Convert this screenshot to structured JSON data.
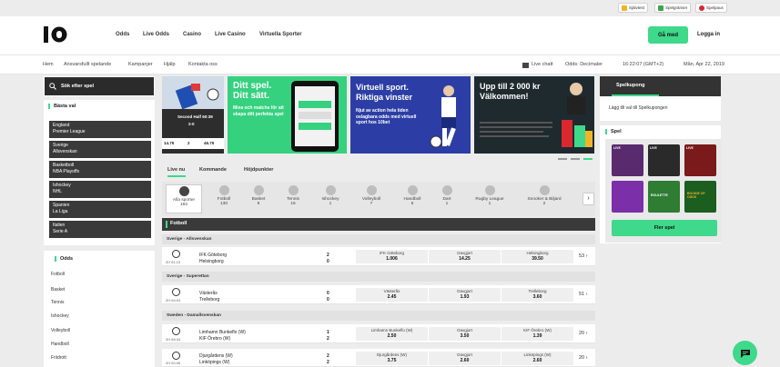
{
  "utility": {
    "sjalvtest": "Självtest",
    "spelgranser": "Spelgränser",
    "spelpaus": "Spelpaus"
  },
  "nav": {
    "items": [
      "Odds",
      "Live Odds",
      "Casino",
      "Live Casino",
      "Virtuella Sporter"
    ],
    "join": "Gå med",
    "login": "Logga in"
  },
  "subnav": {
    "links": [
      "Hem",
      "Ansvarsfullt spelande",
      "Kampanjer",
      "Hjälp",
      "Kontakta oss"
    ],
    "livechatt": "Live chatt",
    "odds_format": "Odds: Decimaler",
    "clock": "16:22:07 (GMT+2)",
    "date": "Mån, Apr 22, 2019"
  },
  "search": {
    "label": "Sök efter spel"
  },
  "bastavid": {
    "title": "Bästa val",
    "items": [
      [
        "England",
        "Premier League"
      ],
      [
        "Sverige",
        "Allsvenskan"
      ],
      [
        "Basketboll",
        "NBA Playoffs"
      ],
      [
        "Ishockey",
        "NHL"
      ],
      [
        "Spanien",
        "La Liga"
      ],
      [
        "Italien",
        "Serie A"
      ]
    ]
  },
  "oddslist": {
    "title": "Odds",
    "items": [
      "Fotboll",
      "Basket",
      "Tennis",
      "Ishockey",
      "Volleyboll",
      "Handboll",
      "Friidrott"
    ]
  },
  "banners": {
    "b1": {
      "line": "Second Half 60:39",
      "score": "2-0",
      "odds": [
        "14.75",
        "2",
        "46.75"
      ]
    },
    "b2": {
      "title1": "Ditt spel.",
      "title2": "Ditt sätt.",
      "body": "Mixa och matcha för att skapa ditt perfekta spel"
    },
    "b3": {
      "title1": "Virtuell sport.",
      "title2": "Riktiga vinster",
      "body": "Njut av action hela tiden oslagbara odds med virtuell sport hos 10bet"
    },
    "b4": {
      "title1": "Upp till 2 000 kr",
      "title2": "Välkommen!"
    }
  },
  "tabs": [
    "Live nu",
    "Kommande",
    "Höjdpunkter"
  ],
  "sports": [
    {
      "name": "Alla sporter",
      "count": "192"
    },
    {
      "name": "Fotboll",
      "count": "130"
    },
    {
      "name": "Basket",
      "count": "9"
    },
    {
      "name": "Tennis",
      "count": "16"
    },
    {
      "name": "Ishockey",
      "count": "1"
    },
    {
      "name": "Volleyboll",
      "count": "7"
    },
    {
      "name": "Handboll",
      "count": "5"
    },
    {
      "name": "Dart",
      "count": "1"
    },
    {
      "name": "Rugby League",
      "count": "1"
    },
    {
      "name": "Snooker & Biljard",
      "count": "2"
    }
  ],
  "section": "Fotboll",
  "matches": [
    {
      "league": "Sverige - Allsvenskan",
      "time": "2H 61:19",
      "home": "IFK Göteborg",
      "away": "Helsingborg",
      "sh": "2",
      "sa": "0",
      "o1": {
        "l": "IFK Göteborg",
        "v": "1.006"
      },
      "ox": {
        "l": "Oavgjort",
        "v": "14.25"
      },
      "o2": {
        "l": "Helsingborg",
        "v": "39.50"
      },
      "more": "53"
    },
    {
      "league": "Sverige - Superettan",
      "time": "2H 64:03",
      "home": "Västerås",
      "away": "Trelleborg",
      "sh": "0",
      "sa": "0",
      "o1": {
        "l": "Västerås",
        "v": "2.45"
      },
      "ox": {
        "l": "Oavgjort",
        "v": "1.93"
      },
      "o2": {
        "l": "Trelleborg",
        "v": "3.60"
      },
      "more": "51"
    },
    {
      "league": "Sweden - Damallsvenskan",
      "time": "2H 66:34",
      "home": "Limhamn Bunkeflo (W)",
      "away": "KIF Örebro (W)",
      "sh": "1",
      "sa": "2",
      "o1": {
        "l": "Limhamn Bunkeflo (W)",
        "v": "2.50"
      },
      "ox": {
        "l": "Oavgjort",
        "v": "3.50"
      },
      "o2": {
        "l": "KIF Örebro (W)",
        "v": "1.39"
      },
      "more": "20"
    },
    {
      "league": "",
      "time": "2H 60:06",
      "home": "Djurgårdens (W)",
      "away": "Linköpings (W)",
      "sh": "2",
      "sa": "2",
      "o1": {
        "l": "Djurgårdens (W)",
        "v": "3.75"
      },
      "ox": {
        "l": "Oavgjort",
        "v": "2.60"
      },
      "o2": {
        "l": "Linköpings (W)",
        "v": "2.60"
      },
      "more": "20"
    }
  ],
  "kupong": {
    "title": "Spelkupong",
    "text": "Lägg till val till Spelkupongen"
  },
  "spel": {
    "title": "Spel",
    "more": "Fler spel",
    "live": "LIVE",
    "game_labels": [
      "ROULETTE",
      "BOOKIE OF ODDS"
    ]
  },
  "colors": {
    "accent": "#3ed98b",
    "dark": "#3a3a3a"
  }
}
